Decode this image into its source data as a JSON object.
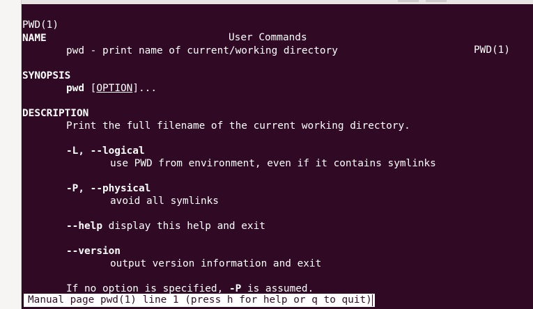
{
  "header": {
    "left": "PWD(1)",
    "center": "User Commands",
    "right": "PWD(1)"
  },
  "name": {
    "heading": "NAME",
    "text": "pwd - print name of current/working directory"
  },
  "synopsis": {
    "heading": "SYNOPSIS",
    "command": "pwd",
    "bracket_open": "[",
    "option": "OPTION",
    "rest": "]..."
  },
  "description": {
    "heading": "DESCRIPTION",
    "intro": "Print the full filename of the current working directory.",
    "options": [
      {
        "flag": "-L, --logical",
        "text": "use PWD from environment, even if it contains symlinks"
      },
      {
        "flag": "-P, --physical",
        "text": "avoid all symlinks"
      },
      {
        "flag": "--help",
        "text": "display this help and exit"
      },
      {
        "flag": "--version",
        "text": "output version information and exit"
      }
    ],
    "footer_pre": "If no option is specified,",
    "footer_flag": "-P",
    "footer_post": "is assumed."
  },
  "status_bar": "Manual page pwd(1) line 1 (press h for help or q to quit)",
  "colors": {
    "terminal_bg": "#300a24",
    "text": "#ffffff"
  }
}
